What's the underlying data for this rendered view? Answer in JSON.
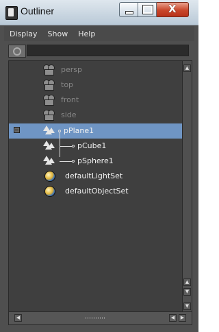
{
  "window": {
    "title": "Outliner",
    "buttons": {
      "minimize": "–",
      "maximize": "□",
      "close": "X"
    }
  },
  "menu": {
    "items": [
      "Display",
      "Show",
      "Help"
    ]
  },
  "filter": {
    "value": "",
    "placeholder": ""
  },
  "tree": {
    "items": [
      {
        "label": "persp",
        "icon": "camera-icon",
        "hidden": true
      },
      {
        "label": "top",
        "icon": "camera-icon",
        "hidden": true
      },
      {
        "label": "front",
        "icon": "camera-icon",
        "hidden": true
      },
      {
        "label": "side",
        "icon": "camera-icon",
        "hidden": true
      },
      {
        "label": "pPlane1",
        "icon": "mesh-icon",
        "selected": true,
        "expanded": true
      },
      {
        "label": "pCube1",
        "icon": "mesh-icon",
        "parent": "pPlane1"
      },
      {
        "label": "pSphere1",
        "icon": "mesh-icon",
        "parent": "pPlane1"
      },
      {
        "label": "defaultLightSet",
        "icon": "set-icon"
      },
      {
        "label": "defaultObjectSet",
        "icon": "set-icon"
      }
    ]
  },
  "colors": {
    "selection": "#6f95c4",
    "panel": "#3f3f3f",
    "window": "#4f4f4f"
  }
}
